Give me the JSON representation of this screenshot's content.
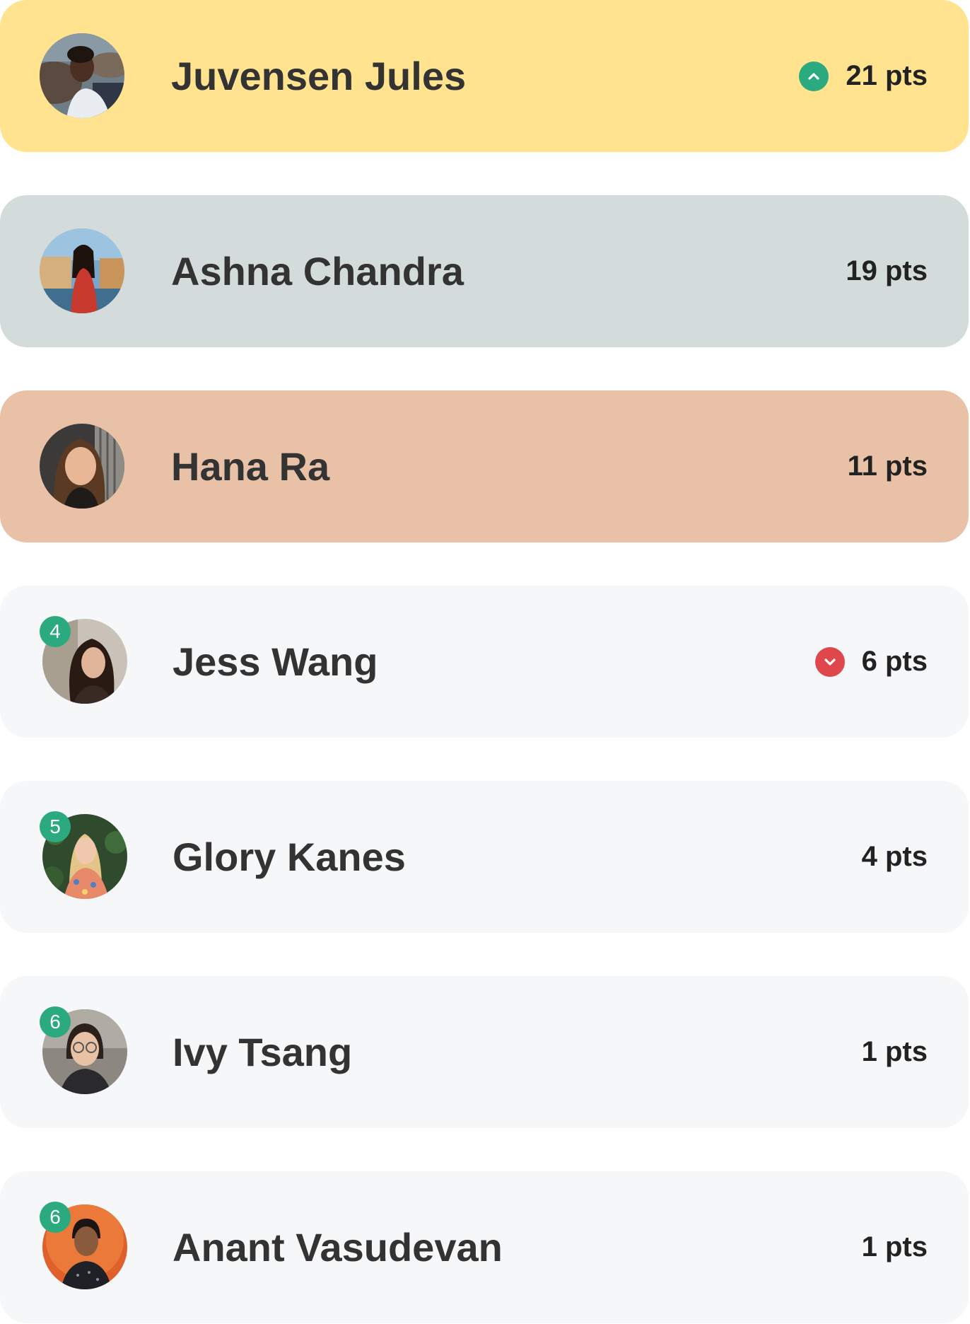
{
  "colors": {
    "first_place_bg": "#FFE38E",
    "second_place_bg": "#D3DCDA",
    "third_place_bg": "#E8C1A7",
    "default_row_bg": "#F5F7F9",
    "rank_badge": "#2BAA7F",
    "trend_up": "#2BAA7F",
    "trend_down": "#E0474C"
  },
  "leaderboard": [
    {
      "name": "Juvensen Jules",
      "points": "21 pts",
      "trend": "up",
      "trend_icon": "chevron-up-icon"
    },
    {
      "name": "Ashna Chandra",
      "points": "19 pts"
    },
    {
      "name": "Hana Ra",
      "points": "11 pts"
    },
    {
      "name": "Jess Wang",
      "points": "6 pts",
      "rank": "4",
      "trend": "down",
      "trend_icon": "chevron-down-icon"
    },
    {
      "name": "Glory Kanes",
      "points": "4 pts",
      "rank": "5"
    },
    {
      "name": "Ivy Tsang",
      "points": "1 pts",
      "rank": "6"
    },
    {
      "name": "Anant Vasudevan",
      "points": "1 pts",
      "rank": "6"
    }
  ]
}
